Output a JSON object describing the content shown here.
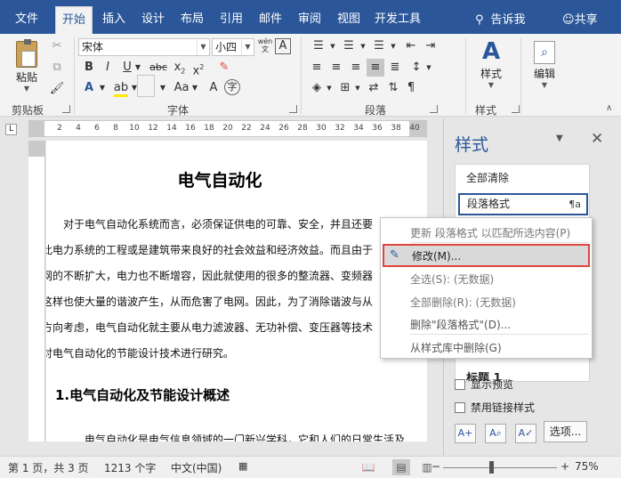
{
  "tabs": [
    {
      "label": "文件"
    },
    {
      "label": "开始"
    },
    {
      "label": "插入"
    },
    {
      "label": "设计"
    },
    {
      "label": "布局"
    },
    {
      "label": "引用"
    },
    {
      "label": "邮件"
    },
    {
      "label": "审阅"
    },
    {
      "label": "视图"
    },
    {
      "label": "开发工具"
    }
  ],
  "tell_me": "告诉我",
  "share": "共享",
  "ribbon": {
    "clipboard": {
      "paste": "粘贴",
      "group_label": "剪贴板"
    },
    "font": {
      "font_name": "宋体",
      "font_size": "小四",
      "wen": "wén",
      "group_label": "字体"
    },
    "paragraph": {
      "group_label": "段落"
    },
    "styles": {
      "label": "样式",
      "group_label": "样式"
    },
    "editing": {
      "label": "编辑"
    }
  },
  "ruler_ticks": [
    "2",
    "4",
    "6",
    "8",
    "10",
    "12",
    "14",
    "16",
    "18",
    "20",
    "22",
    "24",
    "26",
    "28",
    "30",
    "32",
    "34",
    "36",
    "38",
    "40"
  ],
  "document": {
    "title": "电气自动化",
    "lines": [
      "对于电气自动化系统而言，必须保证供电的可靠、安全，并且还要",
      "此电力系统的工程或是建筑带来良好的社会效益和经济效益。而且由于",
      "网的不断扩大，电力也不断增容，因此就使用的很多的整流器、变频器",
      "这样也使大量的谐波产生，从而危害了电网。因此，为了消除谐波与从",
      "方向考虑，电气自动化就主要从电力滤波器、无功补偿、变压器等技术",
      "对电气自动化的节能设计技术进行研究。"
    ],
    "heading1": "1.电气自动化及节能设计概述",
    "cut_line": "电气自动化是电气信息领域的一门新兴学科，它和人们的日常生活及"
  },
  "styles_pane": {
    "title": "样式",
    "clear_all": "全部清除",
    "selected_style": "段落格式",
    "pilcrow": "¶a",
    "list_hidden_item": "标题 1",
    "show_preview": "显示预览",
    "disable_linked": "禁用链接样式",
    "options": "选项..."
  },
  "context_menu": {
    "update": "更新 段落格式 以匹配所选内容(P)",
    "modify": "修改(M)...",
    "select_all": "全选(S): (无数据)",
    "remove_all": "全部删除(R): (无数据)",
    "delete": "删除\"段落格式\"(D)...",
    "remove_gallery": "从样式库中删除(G)"
  },
  "status_bar": {
    "page": "第 1 页，共 3 页",
    "words": "1213 个字",
    "language": "中文(中国)",
    "zoom": "75%",
    "zoom_fraction": 0.42
  }
}
